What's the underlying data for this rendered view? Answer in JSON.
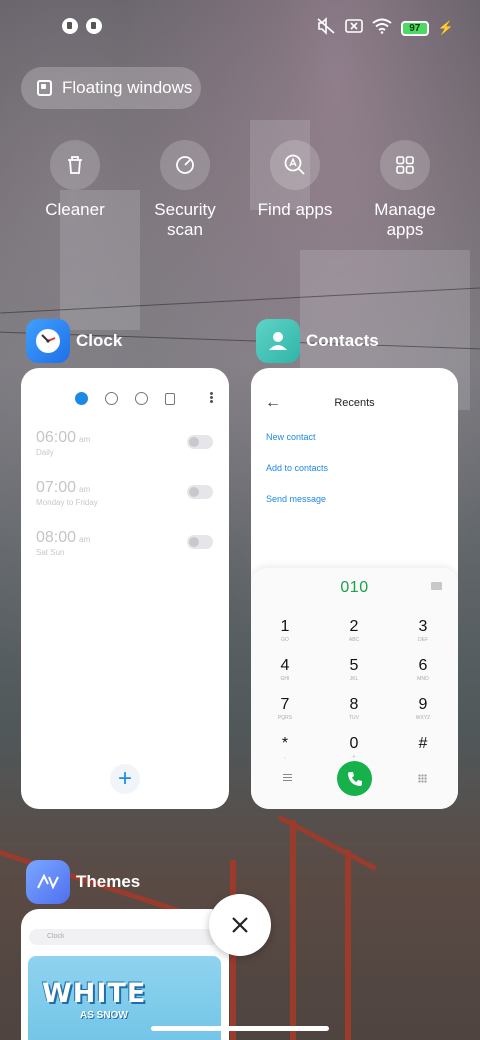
{
  "status_bar": {
    "battery": "97",
    "icons": [
      "notification-icon",
      "notification-icon",
      "mute-icon",
      "no-sim-icon",
      "wifi-icon",
      "battery-icon",
      "charging-icon"
    ]
  },
  "floating_windows": {
    "label": "Floating windows"
  },
  "quick_actions": [
    {
      "label": "Cleaner",
      "icon": "trash-icon"
    },
    {
      "label": "Security scan",
      "icon": "shield-scan-icon"
    },
    {
      "label": "Find apps",
      "icon": "search-apps-icon"
    },
    {
      "label": "Manage apps",
      "icon": "grid-icon"
    }
  ],
  "apps": {
    "clock": {
      "name": "Clock",
      "alarms": [
        {
          "time": "06:00",
          "ampm": "am",
          "repeat": "Daily"
        },
        {
          "time": "07:00",
          "ampm": "am",
          "repeat": "Monday to Friday"
        },
        {
          "time": "08:00",
          "ampm": "am",
          "repeat": "Sat Sun"
        }
      ],
      "fab": "+"
    },
    "contacts": {
      "name": "Contacts",
      "title": "Recents",
      "links": [
        "New contact",
        "Add to contacts",
        "Send message"
      ],
      "dialed_number": "010",
      "keys": [
        {
          "d": "1",
          "l": "GO"
        },
        {
          "d": "2",
          "l": "ABC"
        },
        {
          "d": "3",
          "l": "DEF"
        },
        {
          "d": "4",
          "l": "GHI"
        },
        {
          "d": "5",
          "l": "JKL"
        },
        {
          "d": "6",
          "l": "MNO"
        },
        {
          "d": "7",
          "l": "PQRS"
        },
        {
          "d": "8",
          "l": "TUV"
        },
        {
          "d": "9",
          "l": "WXYZ"
        },
        {
          "d": "*",
          "l": ","
        },
        {
          "d": "0",
          "l": "+"
        },
        {
          "d": "#",
          "l": ""
        }
      ]
    },
    "themes": {
      "name": "Themes",
      "search_placeholder": "Clock",
      "banner_title": "WHITE",
      "banner_sub": "AS SNOW"
    }
  },
  "colors": {
    "accent_blue": "#1e88e5",
    "call_green": "#16b14a"
  }
}
